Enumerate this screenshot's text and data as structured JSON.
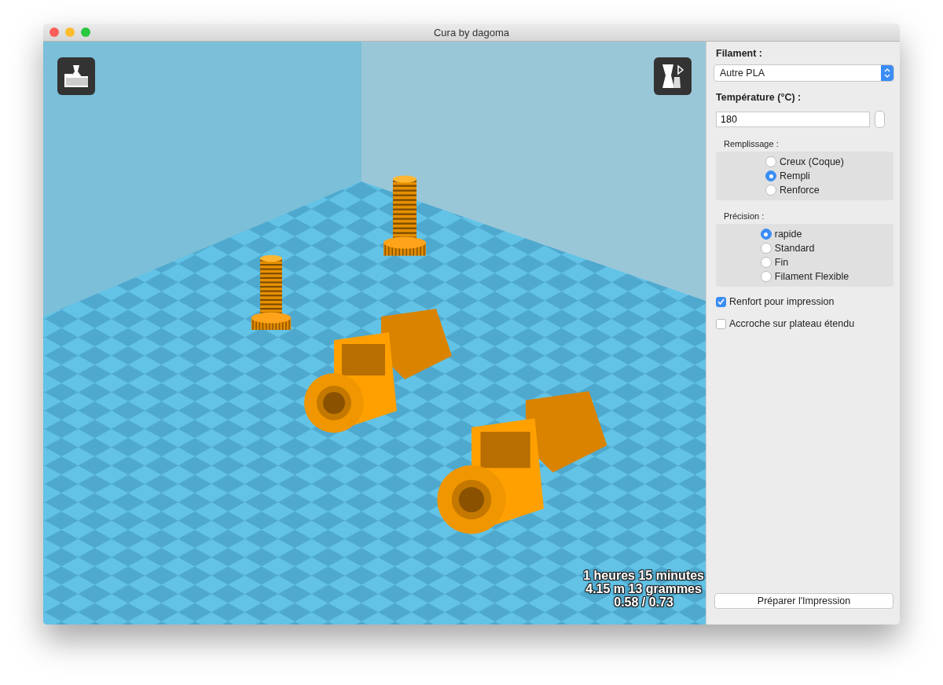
{
  "window": {
    "title": "Cura by dagoma"
  },
  "viewport": {
    "stats": [
      "1 heures 15 minutes",
      "4.15 m 13 grammes",
      "0.58 / 0.73"
    ]
  },
  "sidebar": {
    "filament": {
      "label": "Filament :",
      "value": "Autre PLA"
    },
    "temperature": {
      "label": "Température (°C) :",
      "value": "180"
    },
    "groups": [
      {
        "label": "Remplissage :",
        "options": [
          {
            "label": "Creux (Coque)",
            "selected": false
          },
          {
            "label": "Rempli",
            "selected": true
          },
          {
            "label": "Renforce",
            "selected": false
          }
        ]
      },
      {
        "label": "Précision :",
        "options": [
          {
            "label": "rapide",
            "selected": true
          },
          {
            "label": "Standard",
            "selected": false
          },
          {
            "label": "Fin",
            "selected": false
          },
          {
            "label": "Filament Flexible",
            "selected": false
          }
        ]
      }
    ],
    "checkboxes": [
      {
        "label": "Renfort pour impression",
        "checked": true
      },
      {
        "label": "Accroche sur plateau étendu",
        "checked": false
      }
    ],
    "button": "Préparer l'Impression"
  }
}
